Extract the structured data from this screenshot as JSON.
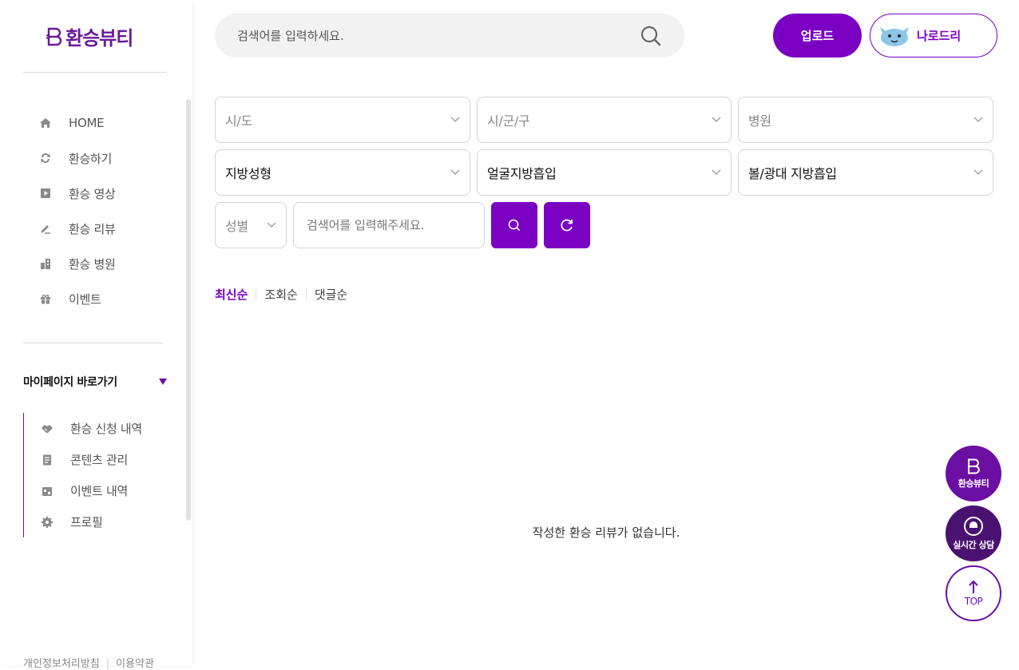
{
  "brand": {
    "name": "환승뷰티",
    "color": "#6a1b9a",
    "accent": "#7a00c2"
  },
  "sidebar": {
    "nav": [
      {
        "label": "HOME",
        "icon": "home-icon"
      },
      {
        "label": "환승하기",
        "icon": "swap-icon"
      },
      {
        "label": "환승 영상",
        "icon": "play-icon"
      },
      {
        "label": "환승 리뷰",
        "icon": "pencil-icon"
      },
      {
        "label": "환승 병원",
        "icon": "building-icon"
      },
      {
        "label": "이벤트",
        "icon": "gift-icon"
      }
    ],
    "mypage_title": "마이페이지 바로가기",
    "mypage_items": [
      {
        "label": "환승 신청 내역",
        "icon": "handshake-icon"
      },
      {
        "label": "콘텐츠 관리",
        "icon": "document-icon"
      },
      {
        "label": "이벤트 내역",
        "icon": "calendar-icon"
      },
      {
        "label": "프로필",
        "icon": "gear-icon"
      }
    ],
    "footer": {
      "privacy": "개인정보처리방침",
      "terms": "이용약관"
    }
  },
  "header": {
    "search_placeholder": "검색어를 입력하세요.",
    "upload_label": "업로드",
    "user_name": "나로드리"
  },
  "filters": {
    "region": "시/도",
    "district": "시/군/구",
    "hospital": "병원",
    "category1": "지방성형",
    "category2": "얼굴지방흡입",
    "category3": "볼/광대 지방흡입",
    "gender": "성별",
    "keyword_placeholder": "검색어를 입력해주세요."
  },
  "sort": {
    "latest": "최신순",
    "views": "조회순",
    "comments": "댓글순",
    "active": "최신순"
  },
  "empty_message": "작성한 환승 리뷰가 없습니다.",
  "floating": {
    "brand_label": "환승뷰티",
    "chat_label": "실시간 상담",
    "top_label": "TOP"
  }
}
